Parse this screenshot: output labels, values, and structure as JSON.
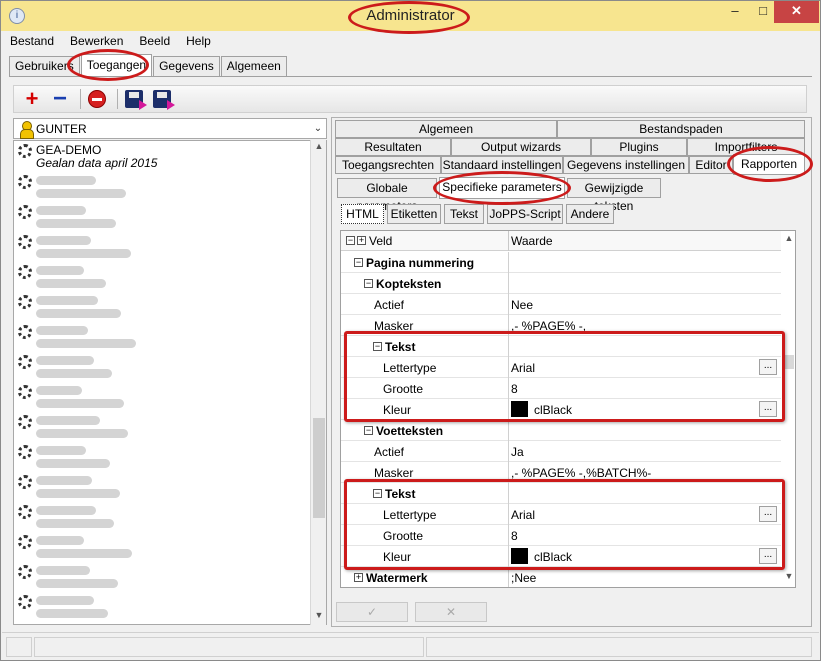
{
  "window": {
    "title": "Administrator",
    "min": "–",
    "max": "□",
    "close": "✕"
  },
  "menu": [
    "Bestand",
    "Bewerken",
    "Beeld",
    "Help"
  ],
  "main_tabs": [
    "Gebruikers",
    "Toegangen",
    "Gegevens",
    "Algemeen"
  ],
  "active_main_tab": "Toegangen",
  "toolbar": {
    "add": "+",
    "remove": "−"
  },
  "user_combo": {
    "value": "GUNTER",
    "arrow": "⌄"
  },
  "tree": {
    "first_item": {
      "title": "GEA-DEMO",
      "subtitle": "Gealan data april 2015"
    }
  },
  "right_tabs": {
    "row1": [
      "Algemeen",
      "Bestandspaden"
    ],
    "row2": [
      "Resultaten",
      "Output wizards",
      "Plugins",
      "Importfilters"
    ],
    "row3": [
      "Toegangsrechten",
      "Standaard instellingen",
      "Gegevens instellingen",
      "Editor",
      "Rapporten"
    ],
    "active": "Rapporten"
  },
  "param_tabs": [
    "Globale parameters",
    "Specifieke parameters",
    "Gewijzigde teksten"
  ],
  "active_param_tab": "Specifieke parameters",
  "format_tabs": [
    "HTML",
    "Etiketten",
    "Tekst",
    "JoPPS-Script",
    "Andere"
  ],
  "active_format_tab": "HTML",
  "grid": {
    "col_veld": "Veld",
    "col_waarde": "Waarde",
    "expand_all": "−",
    "collapse_all": "+",
    "rows": {
      "pagina": {
        "label": "Pagina nummering",
        "exp": "−"
      },
      "koppen": {
        "label": "Kopteksten",
        "exp": "−"
      },
      "k_actief": {
        "label": "Actief",
        "value": "Nee"
      },
      "k_masker": {
        "label": "Masker",
        "value": ",- %PAGE% -,"
      },
      "k_tekst": {
        "label": "Tekst",
        "exp": "−"
      },
      "k_lettertype": {
        "label": "Lettertype",
        "value": "Arial",
        "btn": "..."
      },
      "k_grootte": {
        "label": "Grootte",
        "value": "8"
      },
      "k_kleur": {
        "label": "Kleur",
        "value": "clBlack",
        "btn": "...",
        "color": "#000000"
      },
      "voet": {
        "label": "Voetteksten",
        "exp": "−"
      },
      "v_actief": {
        "label": "Actief",
        "value": "Ja"
      },
      "v_masker": {
        "label": "Masker",
        "value": ",- %PAGE% -,%BATCH%-"
      },
      "v_tekst": {
        "label": "Tekst",
        "exp": "−"
      },
      "v_lettertype": {
        "label": "Lettertype",
        "value": "Arial",
        "btn": "..."
      },
      "v_grootte": {
        "label": "Grootte",
        "value": "8"
      },
      "v_kleur": {
        "label": "Kleur",
        "value": "clBlack",
        "btn": "...",
        "color": "#000000"
      },
      "watermerk": {
        "label": "Watermerk",
        "value": ";Nee",
        "exp": "+"
      }
    }
  },
  "bottom_buttons": {
    "ok": "✓",
    "cancel": "✕"
  },
  "scroll": {
    "up": "▲",
    "down": "▼"
  },
  "colors": {
    "titlebar": "#f7e58f",
    "close_button": "#c74444",
    "annotation_red": "#cc1b1b"
  }
}
